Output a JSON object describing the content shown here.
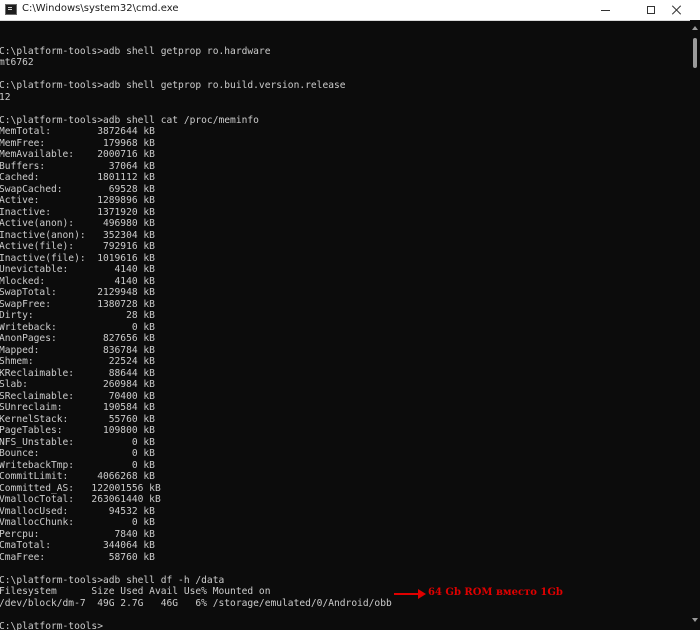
{
  "window": {
    "title": "C:\\Windows\\system32\\cmd.exe",
    "icon": "cmd-icon"
  },
  "terminal": {
    "lines": [
      "",
      "C:\\platform-tools>adb shell getprop ro.hardware",
      "mt6762",
      "",
      "C:\\platform-tools>adb shell getprop ro.build.version.release",
      "12",
      "",
      "C:\\platform-tools>adb shell cat /proc/meminfo",
      "MemTotal:        3872644 kB",
      "MemFree:          179968 kB",
      "MemAvailable:    2000716 kB",
      "Buffers:           37064 kB",
      "Cached:          1801112 kB",
      "SwapCached:        69528 kB",
      "Active:          1289896 kB",
      "Inactive:        1371920 kB",
      "Active(anon):     496980 kB",
      "Inactive(anon):   352304 kB",
      "Active(file):     792916 kB",
      "Inactive(file):  1019616 kB",
      "Unevictable:        4140 kB",
      "Mlocked:            4140 kB",
      "SwapTotal:       2129948 kB",
      "SwapFree:        1380728 kB",
      "Dirty:                28 kB",
      "Writeback:             0 kB",
      "AnonPages:        827656 kB",
      "Mapped:           836784 kB",
      "Shmem:             22524 kB",
      "KReclaimable:      88644 kB",
      "Slab:             260984 kB",
      "SReclaimable:      70400 kB",
      "SUnreclaim:       190584 kB",
      "KernelStack:       55760 kB",
      "PageTables:       109800 kB",
      "NFS_Unstable:          0 kB",
      "Bounce:                0 kB",
      "WritebackTmp:          0 kB",
      "CommitLimit:     4066268 kB",
      "Committed_AS:   122001556 kB",
      "VmallocTotal:   263061440 kB",
      "VmallocUsed:       94532 kB",
      "VmallocChunk:          0 kB",
      "Percpu:             7840 kB",
      "CmaTotal:         344064 kB",
      "CmaFree:           58760 kB",
      "",
      "C:\\platform-tools>adb shell df -h /data",
      "Filesystem      Size Used Avail Use% Mounted on",
      "/dev/block/dm-7  49G 2.7G   46G   6% /storage/emulated/0/Android/obb",
      "",
      "C:\\platform-tools>"
    ]
  },
  "annotation": {
    "text": "64 Gb ROM вместо 1Gb",
    "color": "#e00000"
  }
}
